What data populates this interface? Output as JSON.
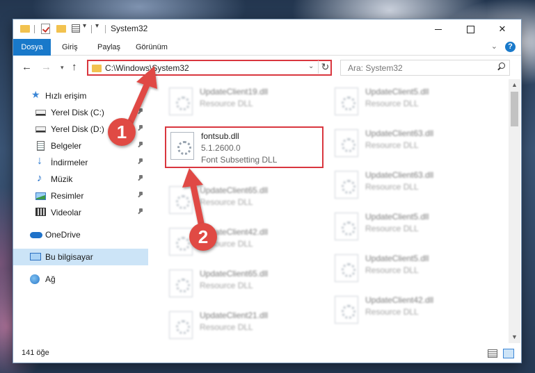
{
  "window": {
    "title": "System32"
  },
  "ribbon": {
    "tabs": [
      "Dosya",
      "Giriş",
      "Paylaş",
      "Görünüm"
    ],
    "help": "?"
  },
  "navigation": {
    "address_path": "C:\\Windows\\System32",
    "search_placeholder": "Ara: System32"
  },
  "sidebar": {
    "items": [
      {
        "label": "Hızlı erişim",
        "icon": "star-icon",
        "pinned": false
      },
      {
        "label": "Yerel Disk (C:)",
        "icon": "drive-icon",
        "pinned": true
      },
      {
        "label": "Yerel Disk (D:)",
        "icon": "drive-icon",
        "pinned": true
      },
      {
        "label": "Belgeler",
        "icon": "documents-icon",
        "pinned": true
      },
      {
        "label": "İndirmeler",
        "icon": "downloads-icon",
        "pinned": true
      },
      {
        "label": "Müzik",
        "icon": "music-icon",
        "pinned": true
      },
      {
        "label": "Resimler",
        "icon": "pictures-icon",
        "pinned": true
      },
      {
        "label": "Videolar",
        "icon": "videos-icon",
        "pinned": true
      },
      {
        "label": "OneDrive",
        "icon": "onedrive-icon",
        "pinned": false
      },
      {
        "label": "Bu bilgisayar",
        "icon": "this-pc-icon",
        "pinned": false,
        "selected": true
      },
      {
        "label": "Ağ",
        "icon": "network-icon",
        "pinned": false
      }
    ]
  },
  "files": {
    "selected": {
      "name": "fontsub.dll",
      "version": "5.1.2600.0",
      "description": "Font Subsetting DLL"
    },
    "column_left": [
      {
        "name": "UpdateClient19.dll",
        "description": "Resource DLL"
      },
      {
        "name": "UpdateClient65.dll",
        "description": "Resource DLL"
      },
      {
        "name": "UpdateClient42.dll",
        "description": "Resource DLL"
      },
      {
        "name": "UpdateClient65.dll",
        "description": "Resource DLL"
      },
      {
        "name": "UpdateClient21.dll",
        "description": "Resource DLL"
      }
    ],
    "column_right": [
      {
        "name": "UpdateClient5.dll",
        "description": "Resource DLL"
      },
      {
        "name": "UpdateClient63.dll",
        "description": "Resource DLL"
      },
      {
        "name": "UpdateClient63.dll",
        "description": "Resource DLL"
      },
      {
        "name": "UpdateClient5.dll",
        "description": "Resource DLL"
      },
      {
        "name": "UpdateClient5.dll",
        "description": "Resource DLL"
      },
      {
        "name": "UpdateClient42.dll",
        "description": "Resource DLL"
      }
    ]
  },
  "status": {
    "item_count": "141 öğe"
  },
  "annotations": {
    "step1": "1",
    "step2": "2",
    "color": "#e04a44"
  }
}
